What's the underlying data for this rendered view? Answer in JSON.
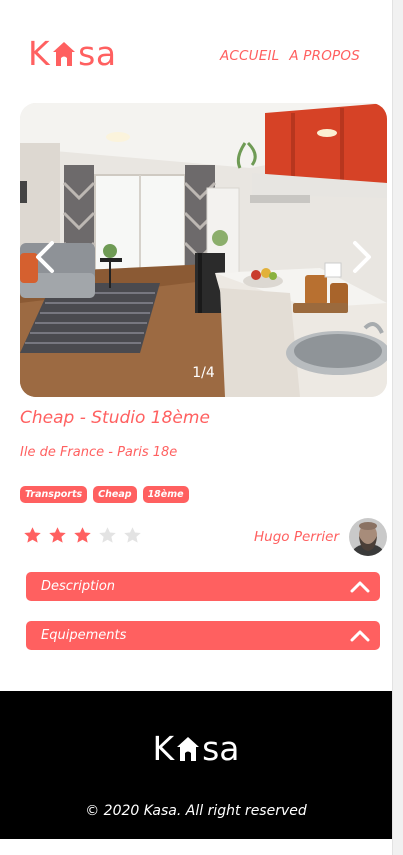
{
  "header": {
    "logo_prefix": "K",
    "logo_suffix": "sa",
    "nav": {
      "home": "ACCUEIL",
      "about": "A PROPOS"
    }
  },
  "gallery": {
    "counter": "1/4"
  },
  "listing": {
    "title": "Cheap - Studio 18ème",
    "location": "Ile de France - Paris 18e",
    "tags": [
      "Transports",
      "Cheap",
      "18ème"
    ],
    "rating": 3,
    "rating_max": 5,
    "host_name": "Hugo Perrier"
  },
  "collapses": [
    {
      "label": "Description"
    },
    {
      "label": "Equipements"
    }
  ],
  "footer": {
    "logo_prefix": "K",
    "logo_suffix": "sa",
    "copyright": "© 2020 Kasa. All right reserved"
  },
  "colors": {
    "accent": "#FF6060",
    "footer_bg": "#000000",
    "inactive_star": "#E3E3E3"
  },
  "icons": [
    "house-icon",
    "chevron-left-icon",
    "chevron-right-icon",
    "star-icon",
    "chevron-up-icon"
  ]
}
